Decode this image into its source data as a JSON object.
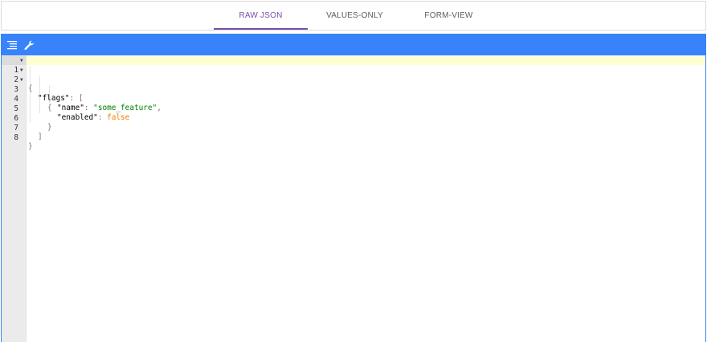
{
  "tabs": [
    {
      "label": "RAW JSON",
      "active": true
    },
    {
      "label": "VALUES-ONLY",
      "active": false
    },
    {
      "label": "FORM-VIEW",
      "active": false
    }
  ],
  "toolbar": {
    "format_icon": "format-lines-icon",
    "repair_icon": "wrench-icon"
  },
  "colors": {
    "toolbar": "#3883fa",
    "tab_active": "#7b4fa6",
    "string": "#008000",
    "boolean": "#ee7f00",
    "active_line": "#ffffd2",
    "gutter": "#ebebeb"
  },
  "editor": {
    "lines": [
      {
        "num": "1",
        "fold": true
      },
      {
        "num": "2",
        "fold": true
      },
      {
        "num": "3",
        "fold": true
      },
      {
        "num": "4",
        "fold": false
      },
      {
        "num": "5",
        "fold": false
      },
      {
        "num": "6",
        "fold": false
      },
      {
        "num": "7",
        "fold": false
      },
      {
        "num": "8",
        "fold": false
      }
    ],
    "tokens": {
      "open_brace": "{",
      "flags_key": "\"flags\"",
      "colon": ": ",
      "open_bracket": "[",
      "obj_open": "{",
      "name_key": "\"name\"",
      "name_value": "\"some_feature\"",
      "comma": ",",
      "enabled_key": "\"enabled\"",
      "enabled_value": "false",
      "obj_close": "}",
      "close_bracket": "]",
      "close_brace": "}"
    }
  }
}
